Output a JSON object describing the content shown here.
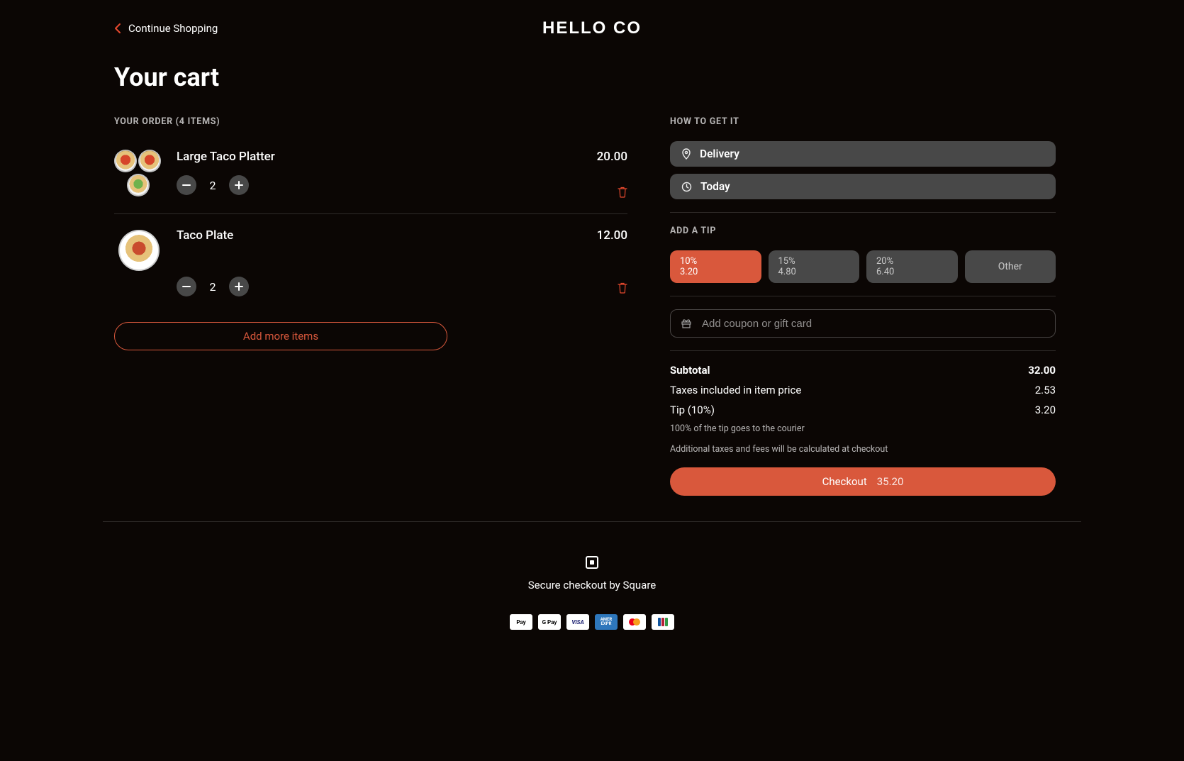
{
  "header": {
    "back_label": "Continue Shopping",
    "brand": "HELLO CO"
  },
  "page_title": "Your cart",
  "order": {
    "section_label": "YOUR ORDER (4 ITEMS)",
    "items": [
      {
        "name": "Large Taco Platter",
        "price": "20.00",
        "qty": "2"
      },
      {
        "name": "Taco Plate",
        "price": "12.00",
        "qty": "2"
      }
    ],
    "add_more_label": "Add more items"
  },
  "fulfillment": {
    "section_label": "HOW TO GET IT",
    "method": "Delivery",
    "when": "Today"
  },
  "tip": {
    "section_label": "ADD A TIP",
    "options": [
      {
        "pct": "10%",
        "amt": "3.20",
        "selected": true
      },
      {
        "pct": "15%",
        "amt": "4.80",
        "selected": false
      },
      {
        "pct": "20%",
        "amt": "6.40",
        "selected": false
      }
    ],
    "other_label": "Other"
  },
  "coupon": {
    "placeholder": "Add coupon or gift card"
  },
  "summary": {
    "subtotal_label": "Subtotal",
    "subtotal": "32.00",
    "tax_label": "Taxes included in item price",
    "tax": "2.53",
    "tip_label": "Tip (10%)",
    "tip": "3.20",
    "tip_note": "100% of the tip goes to the courier",
    "fees_note": "Additional taxes and fees will be calculated at checkout",
    "checkout_label": "Checkout",
    "checkout_total": "35.20"
  },
  "footer": {
    "secure_label": "Secure checkout by Square",
    "cards": [
      "apple-pay",
      "google-pay",
      "visa",
      "amex",
      "mastercard",
      "jcb"
    ]
  }
}
